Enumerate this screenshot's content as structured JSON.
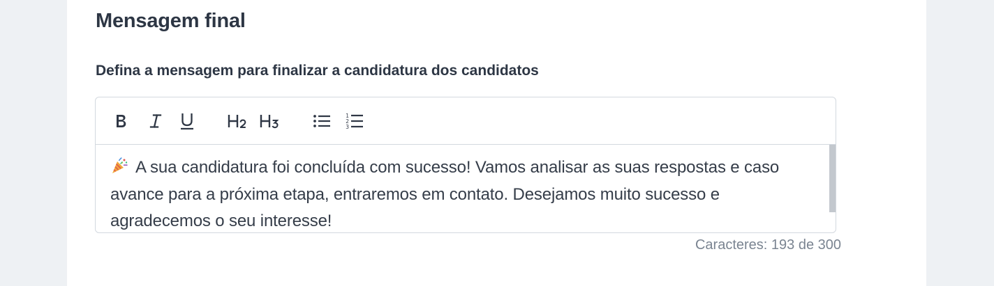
{
  "section": {
    "title": "Mensagem final",
    "subtitle": "Defina a mensagem para finalizar a candidatura dos candidatos"
  },
  "editor": {
    "toolbar": {
      "bold": "B",
      "italic": "I",
      "underline": "U",
      "heading2": "H2",
      "heading3": "H3",
      "bullet_list": "bullet-list-icon",
      "ordered_list": "ordered-list-icon"
    },
    "content_icon": "party-popper-icon",
    "content": "A sua candidatura foi concluída com sucesso! Vamos analisar as suas respostas e caso avance para a próxima etapa, entraremos em contato. Desejamos muito sucesso e agradecemos o seu interesse!"
  },
  "counter": {
    "text": "Caracteres: 193 de 300"
  },
  "colors": {
    "background": "#eef1f4",
    "card": "#ffffff",
    "border": "#d3d8df",
    "text": "#2d3644",
    "muted": "#7a8491",
    "scrollbar": "#c3c8ce"
  }
}
